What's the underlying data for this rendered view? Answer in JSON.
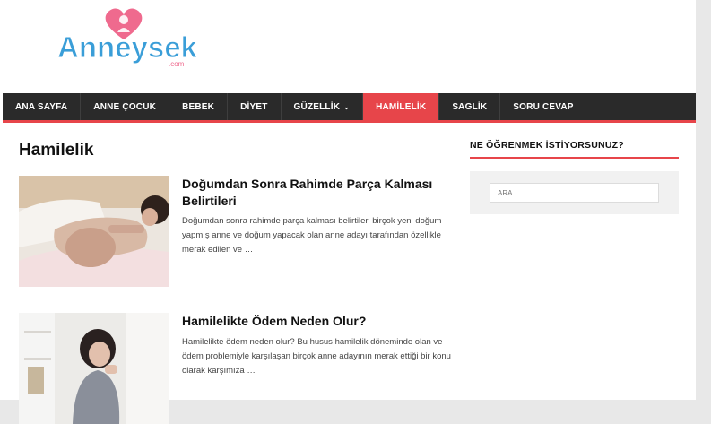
{
  "brand": {
    "logo_text": "Anneysek",
    "logo_suffix": ".com",
    "colors": {
      "accent": "#e7454a",
      "nav_bg": "#2a2a2a",
      "logo_blue": "#3a9ed8",
      "logo_pink": "#ef6a8e"
    }
  },
  "nav": {
    "items": [
      {
        "label": "ANA SAYFA"
      },
      {
        "label": "ANNE ÇOCUK"
      },
      {
        "label": "BEBEK"
      },
      {
        "label": "DİYET"
      },
      {
        "label": "GÜZELLİK",
        "caret": "⌄"
      },
      {
        "label": "HAMİLELİK",
        "active": true
      },
      {
        "label": "SAGLİK"
      },
      {
        "label": "SORU CEVAP"
      }
    ]
  },
  "main": {
    "page_title": "Hamilelik",
    "articles": [
      {
        "title": "Doğumdan Sonra Rahimde Parça Kalması Belirtileri",
        "excerpt": "Doğumdan sonra rahimde parça kalması belirtileri birçok yeni doğum yapmış anne ve doğum yapacak olan anne adayı tarafından özellikle merak edilen ve …"
      },
      {
        "title": "Hamilelikte Ödem Neden Olur?",
        "excerpt": "Hamilelikte ödem neden olur? Bu husus hamilelik döneminde olan ve ödem problemiyle karşılaşan birçok anne adayının merak ettiği bir konu olarak karşımıza …"
      }
    ]
  },
  "sidebar": {
    "widget_title": "NE ÖĞRENMEK İSTİYORSUNUZ?",
    "search_placeholder": "ARA ..."
  }
}
